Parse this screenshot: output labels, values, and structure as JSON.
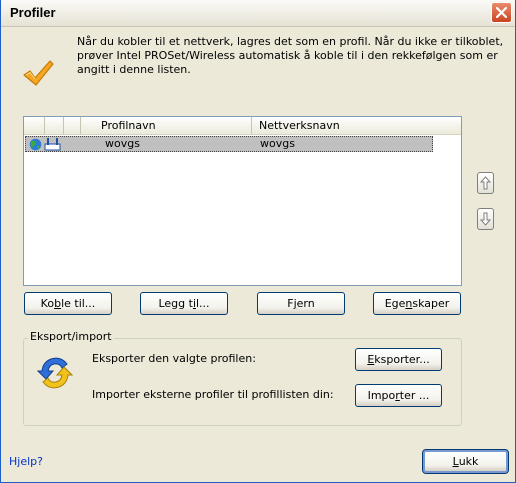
{
  "window": {
    "title": "Profiler"
  },
  "intro_text": "Når du kobler til et nettverk, lagres det som en profil. Når du ikke er tilkoblet, prøver Intel PROSet/Wireless automatisk å koble til i den rekkefølgen som er angitt i denne listen.",
  "profile_list": {
    "columns": [
      "",
      "",
      "",
      "Profilnavn",
      "Nettverksnavn"
    ],
    "rows": [
      {
        "profile_name": "wovgs",
        "network_name": "wovgs",
        "icons": [
          "globe-icon",
          "adapter-icon"
        ]
      }
    ]
  },
  "buttons": {
    "connect": {
      "pre": "Ko",
      "key": "b",
      "post": "le til..."
    },
    "add": {
      "pre": "Legg t",
      "key": "i",
      "post": "l..."
    },
    "remove": {
      "pre": "F",
      "key": "j",
      "post": "ern"
    },
    "properties": {
      "pre": "Ege",
      "key": "n",
      "post": "skaper"
    },
    "export": {
      "pre": "",
      "key": "E",
      "post": "ksporter..."
    },
    "import": {
      "pre": "Impo",
      "key": "r",
      "post": "ter ..."
    },
    "close": {
      "pre": "",
      "key": "L",
      "post": "ukk"
    }
  },
  "export_import": {
    "label": "Eksport/import",
    "export_text": "Eksporter den valgte profilen:",
    "import_text": "Importer eksterne profiler til profillisten din:"
  },
  "help_link": "Hjelp?",
  "colors": {
    "title_close": "#C94421",
    "selection": "#C0C0C0",
    "link": "#0033CC",
    "border": "#7F9DB9"
  }
}
